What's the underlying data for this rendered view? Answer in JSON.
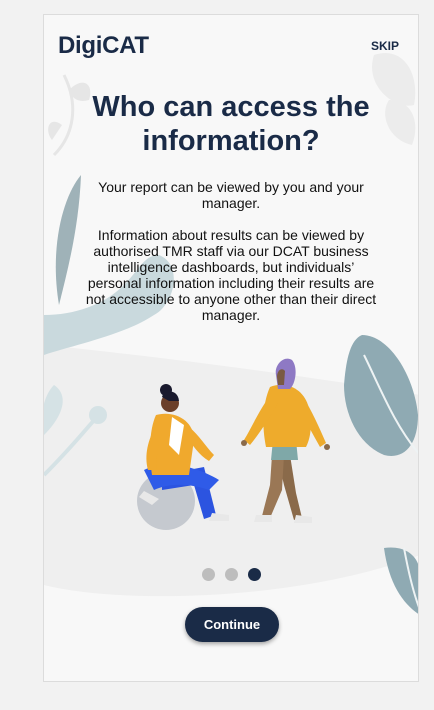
{
  "header": {
    "logo": "DigiCAT",
    "skip_label": "SKIP"
  },
  "main": {
    "title": "Who can access the\ninformation?",
    "paragraphs": [
      "Your report can be viewed by you and your manager.",
      "Information about results can be viewed by authorised TMR staff via our DCAT business intelligence dashboards, but individuals’ personal information including their results are not accessible to anyone other than their direct manager."
    ]
  },
  "pagination": {
    "total": 3,
    "current": 3
  },
  "footer": {
    "continue_label": "Continue"
  },
  "colors": {
    "primary": "#1a2b47",
    "leaf": "#8faab3",
    "dot_inactive": "#bdbdbd"
  }
}
